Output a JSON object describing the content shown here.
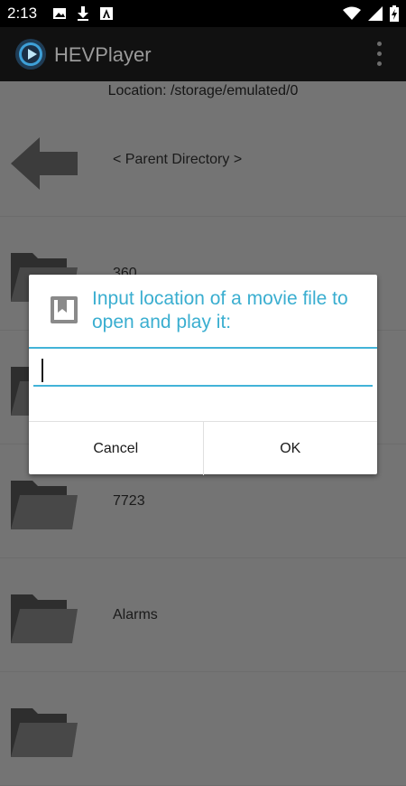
{
  "status_bar": {
    "time": "2:13",
    "icons_left": [
      "image-icon",
      "download-icon",
      "a-box-icon"
    ],
    "icons_right": [
      "wifi-icon",
      "signal-icon",
      "battery-icon"
    ]
  },
  "app_bar": {
    "title": "HEVPlayer",
    "logo": "hevplayer-logo-icon",
    "menu": "overflow-menu-icon"
  },
  "location": "Location: /storage/emulated/0",
  "file_list": [
    {
      "label": "< Parent Directory >",
      "icon": "back-arrow-icon"
    },
    {
      "label": "360",
      "icon": "folder-icon"
    },
    {
      "label": "",
      "icon": "folder-icon"
    },
    {
      "label": "7723",
      "icon": "folder-icon"
    },
    {
      "label": "Alarms",
      "icon": "folder-icon"
    },
    {
      "label": "",
      "icon": "folder-icon"
    }
  ],
  "dialog": {
    "title": "Input location of a movie file to open and play it:",
    "icon": "bookmark-icon",
    "input_value": "",
    "cancel_label": "Cancel",
    "ok_label": "OK"
  },
  "colors": {
    "accent": "#3aaed0",
    "appbar": "#111111",
    "scrim_background": "#747474"
  }
}
